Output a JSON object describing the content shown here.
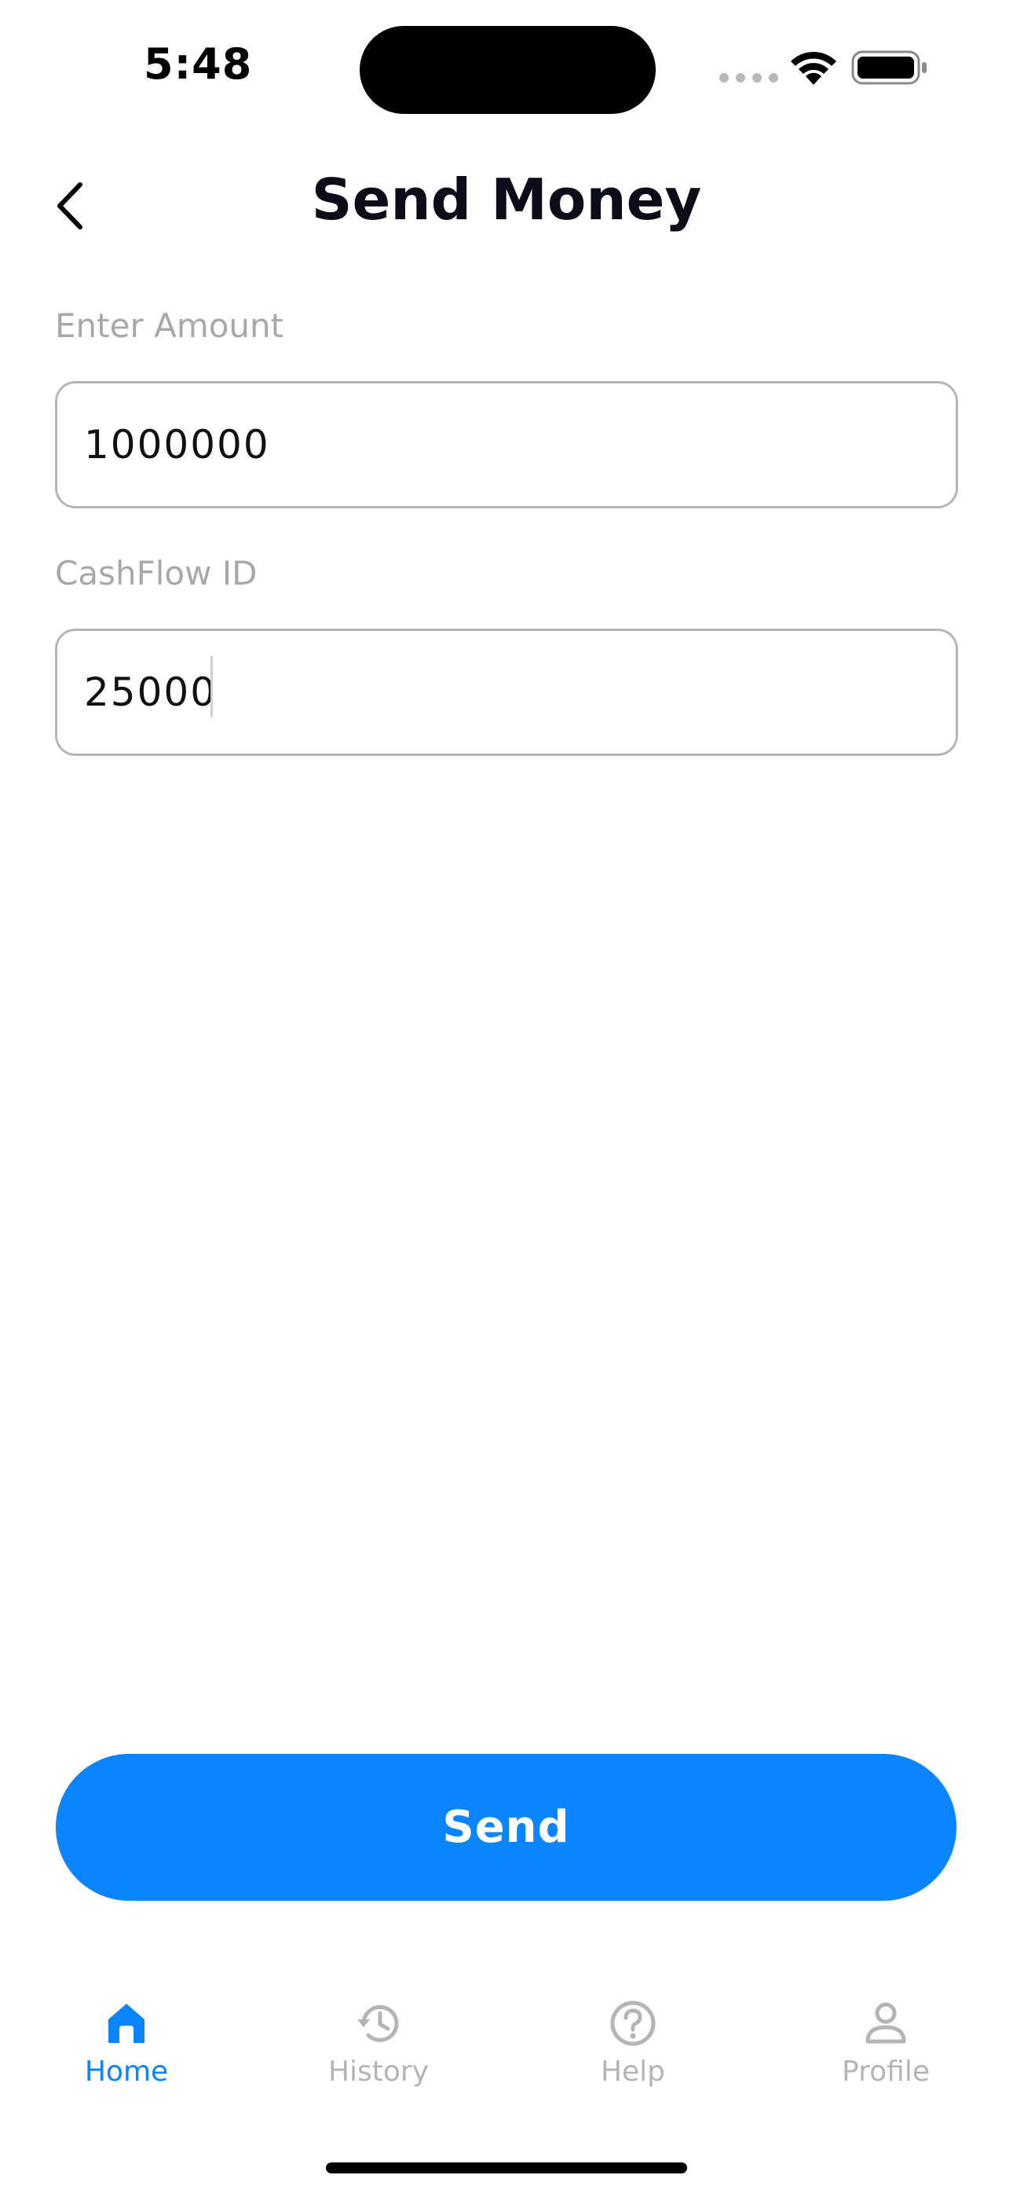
{
  "status_bar": {
    "time": "5:48"
  },
  "header": {
    "title": "Send Money"
  },
  "form": {
    "amount_label": "Enter Amount",
    "amount_value": "1000000",
    "id_label": "CashFlow ID",
    "id_value": "25000"
  },
  "actions": {
    "send_label": "Send"
  },
  "tab_bar": {
    "items": [
      {
        "label": "Home",
        "icon": "home-icon",
        "active": true
      },
      {
        "label": "History",
        "icon": "history-icon",
        "active": false
      },
      {
        "label": "Help",
        "icon": "help-icon",
        "active": false
      },
      {
        "label": "Profile",
        "icon": "profile-icon",
        "active": false
      }
    ]
  },
  "colors": {
    "accent": "#0a84ff",
    "inactive": "#b4b4b4",
    "label": "#a8a8a8",
    "border": "#b5b5b5",
    "title": "#0d0d1a"
  }
}
